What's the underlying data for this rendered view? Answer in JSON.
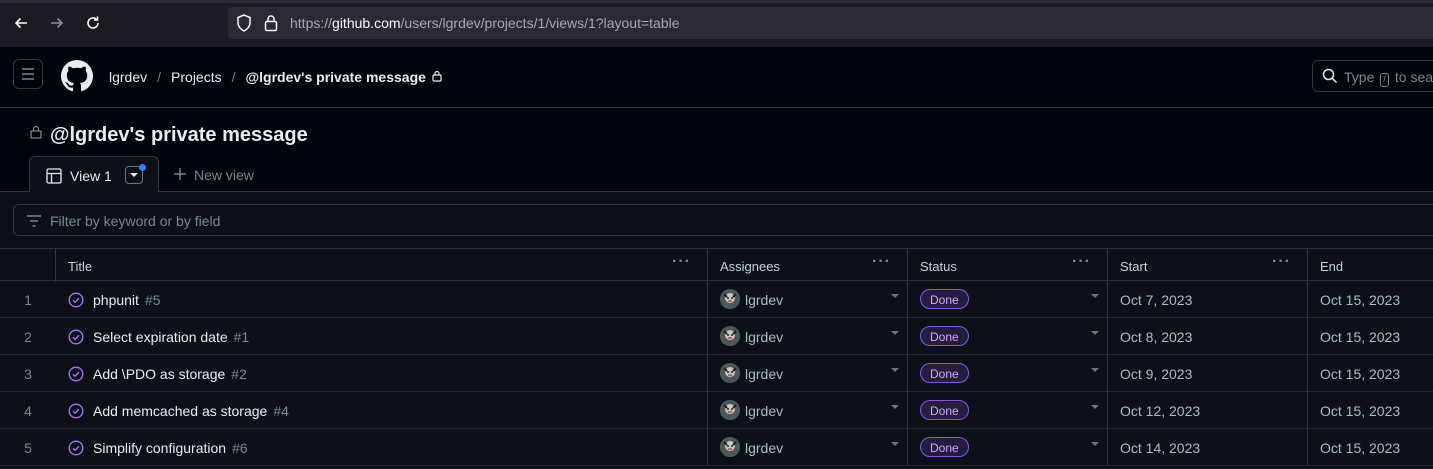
{
  "browser": {
    "url_prefix": "https://",
    "url_host": "github.com",
    "url_path": "/users/lgrdev/projects/1/views/1?layout=table"
  },
  "header": {
    "breadcrumb_user": "lgrdev",
    "breadcrumb_sep1": "/",
    "breadcrumb_projects": "Projects",
    "breadcrumb_sep2": "/",
    "breadcrumb_current": "@lgrdev's private message",
    "search_placeholder_pre": "Type",
    "search_key": "/",
    "search_placeholder_post": "to sear"
  },
  "project": {
    "title": "@lgrdev's private message"
  },
  "tabs": {
    "active_label": "View 1",
    "new_view_label": "New view"
  },
  "filter": {
    "placeholder": "Filter by keyword or by field"
  },
  "table": {
    "columns": {
      "title": "Title",
      "assignees": "Assignees",
      "status": "Status",
      "start": "Start",
      "end": "End"
    },
    "rows": [
      {
        "n": "1",
        "title": "phpunit",
        "num": "#5",
        "assignee": "lgrdev",
        "status": "Done",
        "start": "Oct 7, 2023",
        "end": "Oct 15, 2023"
      },
      {
        "n": "2",
        "title": "Select expiration date",
        "num": "#1",
        "assignee": "lgrdev",
        "status": "Done",
        "start": "Oct 8, 2023",
        "end": "Oct 15, 2023"
      },
      {
        "n": "3",
        "title": "Add \\PDO as storage",
        "num": "#2",
        "assignee": "lgrdev",
        "status": "Done",
        "start": "Oct 9, 2023",
        "end": "Oct 15, 2023"
      },
      {
        "n": "4",
        "title": "Add memcached as storage",
        "num": "#4",
        "assignee": "lgrdev",
        "status": "Done",
        "start": "Oct 12, 2023",
        "end": "Oct 15, 2023"
      },
      {
        "n": "5",
        "title": "Simplify configuration",
        "num": "#6",
        "assignee": "lgrdev",
        "status": "Done",
        "start": "Oct 14, 2023",
        "end": "Oct 15, 2023"
      }
    ]
  },
  "colors": {
    "accent_blue": "#2f81f7",
    "done_purple": "#8957e5"
  }
}
